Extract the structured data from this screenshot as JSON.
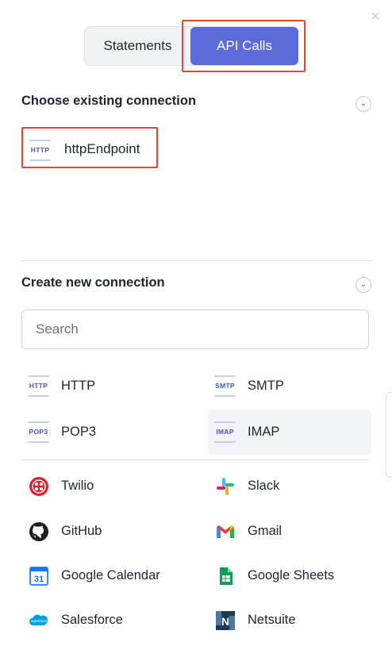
{
  "close_label": "×",
  "tabs": {
    "statements": "Statements",
    "api_calls": "API Calls",
    "active": "API Calls"
  },
  "existing": {
    "title": "Choose existing connection",
    "collapse_icon": "chevron-down-icon",
    "items": [
      {
        "icon_text": "HTTP",
        "label": "httpEndpoint"
      }
    ]
  },
  "create": {
    "title": "Create new connection",
    "collapse_icon": "chevron-down-icon",
    "search_placeholder": "Search",
    "protocols": [
      {
        "icon_text": "HTTP",
        "label": "HTTP"
      },
      {
        "icon_text": "SMTP",
        "label": "SMTP"
      },
      {
        "icon_text": "POP3",
        "label": "POP3"
      },
      {
        "icon_text": "IMAP",
        "label": "IMAP"
      }
    ],
    "apps": [
      {
        "icon": "twilio-icon",
        "label": "Twilio"
      },
      {
        "icon": "slack-icon",
        "label": "Slack"
      },
      {
        "icon": "github-icon",
        "label": "GitHub"
      },
      {
        "icon": "gmail-icon",
        "label": "Gmail"
      },
      {
        "icon": "google-calendar-icon",
        "label": "Google Calendar",
        "icon_text": "31"
      },
      {
        "icon": "google-sheets-icon",
        "label": "Google Sheets"
      },
      {
        "icon": "salesforce-icon",
        "label": "Salesforce",
        "icon_text": "salesforce"
      },
      {
        "icon": "netsuite-icon",
        "label": "Netsuite",
        "icon_text": "N"
      }
    ]
  },
  "colors": {
    "accent": "#5c6bdc",
    "highlight": "#e8452c",
    "protocol_icon": "#4556c9"
  }
}
